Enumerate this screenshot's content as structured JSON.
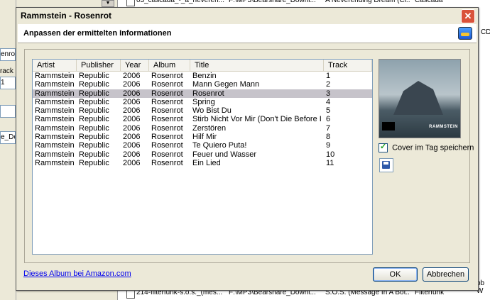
{
  "background": {
    "left_fields": [
      "enrot",
      "rack",
      "1",
      "e_Do"
    ],
    "rows_top": [
      {
        "file": "03_cascada_-_a_neveren...",
        "path": "F:\\MP3\\Bearshare_Downl...",
        "title": "A Neverending Dream (Cl...",
        "artist": "Cascada"
      }
    ],
    "rows_bottom": [
      {
        "file": "214-filterfunk-s.o.s._(mes...",
        "path": "F:\\MP3\\Bearshare_Downl...",
        "title": "S.O.S. (Message In A Bot...",
        "artist": "Filterfunk"
      }
    ],
    "right_cut_top": "CD",
    "right_cut_bottom": "ob W"
  },
  "dialog": {
    "title": "Rammstein - Rosenrot",
    "close_glyph": "✕",
    "header": "Anpassen der ermittelten Informationen",
    "columns": [
      "Artist",
      "Publisher",
      "Year",
      "Album",
      "Title",
      "Track"
    ],
    "tracks": [
      {
        "artist": "Rammstein",
        "publisher": "Republic",
        "year": "2006",
        "album": "Rosenrot",
        "title": "Benzin",
        "track": "1"
      },
      {
        "artist": "Rammstein",
        "publisher": "Republic",
        "year": "2006",
        "album": "Rosenrot",
        "title": "Mann Gegen Mann",
        "track": "2"
      },
      {
        "artist": "Rammstein",
        "publisher": "Republic",
        "year": "2006",
        "album": "Rosenrot",
        "title": "Rosenrot",
        "track": "3"
      },
      {
        "artist": "Rammstein",
        "publisher": "Republic",
        "year": "2006",
        "album": "Rosenrot",
        "title": "Spring",
        "track": "4"
      },
      {
        "artist": "Rammstein",
        "publisher": "Republic",
        "year": "2006",
        "album": "Rosenrot",
        "title": "Wo Bist Du",
        "track": "5"
      },
      {
        "artist": "Rammstein",
        "publisher": "Republic",
        "year": "2006",
        "album": "Rosenrot",
        "title": "Stirb Nicht Vor Mir (Don't Die Before I Do)",
        "track": "6"
      },
      {
        "artist": "Rammstein",
        "publisher": "Republic",
        "year": "2006",
        "album": "Rosenrot",
        "title": "Zerstören",
        "track": "7"
      },
      {
        "artist": "Rammstein",
        "publisher": "Republic",
        "year": "2006",
        "album": "Rosenrot",
        "title": "Hilf Mir",
        "track": "8"
      },
      {
        "artist": "Rammstein",
        "publisher": "Republic",
        "year": "2006",
        "album": "Rosenrot",
        "title": "Te Quiero Puta!",
        "track": "9"
      },
      {
        "artist": "Rammstein",
        "publisher": "Republic",
        "year": "2006",
        "album": "Rosenrot",
        "title": "Feuer und Wasser",
        "track": "10"
      },
      {
        "artist": "Rammstein",
        "publisher": "Republic",
        "year": "2006",
        "album": "Rosenrot",
        "title": "Ein Lied",
        "track": "11"
      }
    ],
    "selected_track_index": 2,
    "cover_text": "RAMMSTEIN",
    "cover_checkbox_label": "Cover im Tag speichern",
    "cover_checkbox_checked": true,
    "amazon_link": "Dieses Album bei Amazon.com",
    "ok_label": "OK",
    "cancel_label": "Abbrechen"
  }
}
